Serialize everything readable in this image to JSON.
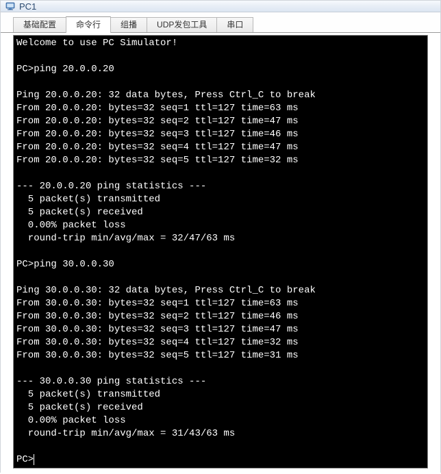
{
  "titlebar": {
    "icon_name": "pc-icon",
    "title": "PC1"
  },
  "tabs": [
    {
      "label": "基础配置",
      "active": false
    },
    {
      "label": "命令行",
      "active": true
    },
    {
      "label": "组播",
      "active": false
    },
    {
      "label": "UDP发包工具",
      "active": false
    },
    {
      "label": "串口",
      "active": false
    }
  ],
  "terminal": {
    "lines": [
      "Welcome to use PC Simulator!",
      "",
      "PC>ping 20.0.0.20",
      "",
      "Ping 20.0.0.20: 32 data bytes, Press Ctrl_C to break",
      "From 20.0.0.20: bytes=32 seq=1 ttl=127 time=63 ms",
      "From 20.0.0.20: bytes=32 seq=2 ttl=127 time=47 ms",
      "From 20.0.0.20: bytes=32 seq=3 ttl=127 time=46 ms",
      "From 20.0.0.20: bytes=32 seq=4 ttl=127 time=47 ms",
      "From 20.0.0.20: bytes=32 seq=5 ttl=127 time=32 ms",
      "",
      "--- 20.0.0.20 ping statistics ---",
      "  5 packet(s) transmitted",
      "  5 packet(s) received",
      "  0.00% packet loss",
      "  round-trip min/avg/max = 32/47/63 ms",
      "",
      "PC>ping 30.0.0.30",
      "",
      "Ping 30.0.0.30: 32 data bytes, Press Ctrl_C to break",
      "From 30.0.0.30: bytes=32 seq=1 ttl=127 time=63 ms",
      "From 30.0.0.30: bytes=32 seq=2 ttl=127 time=46 ms",
      "From 30.0.0.30: bytes=32 seq=3 ttl=127 time=47 ms",
      "From 30.0.0.30: bytes=32 seq=4 ttl=127 time=32 ms",
      "From 30.0.0.30: bytes=32 seq=5 ttl=127 time=31 ms",
      "",
      "--- 30.0.0.30 ping statistics ---",
      "  5 packet(s) transmitted",
      "  5 packet(s) received",
      "  0.00% packet loss",
      "  round-trip min/avg/max = 31/43/63 ms",
      ""
    ],
    "prompt": "PC>",
    "input_value": ""
  }
}
